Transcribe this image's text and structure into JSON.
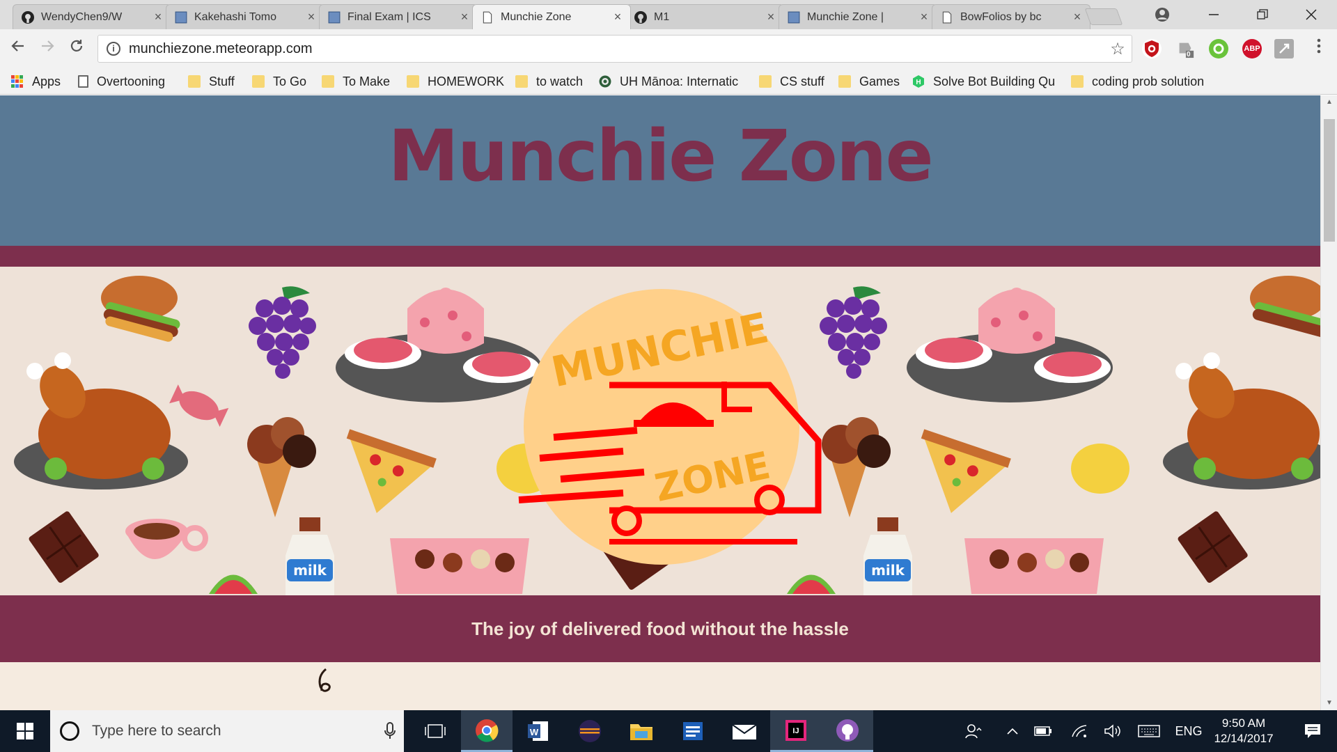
{
  "tabs": [
    {
      "title": "WendyChen9/W",
      "icon": "github-icon"
    },
    {
      "title": "Kakehashi Tomo",
      "icon": "page-blue-icon"
    },
    {
      "title": "Final Exam | ICS",
      "icon": "page-blue-icon"
    },
    {
      "title": "Munchie Zone",
      "icon": "page-icon"
    },
    {
      "title": "M1",
      "icon": "github-icon"
    },
    {
      "title": "Munchie Zone |",
      "icon": "page-blue-icon"
    },
    {
      "title": "BowFolios by bc",
      "icon": "page-icon"
    }
  ],
  "tab_close": "×",
  "address": {
    "url": "munchiezone.meteorapp.com"
  },
  "bookmarks": [
    {
      "label": "Apps",
      "icon": "apps-icon"
    },
    {
      "label": "Overtooning",
      "icon": "page-icon"
    },
    {
      "label": "Stuff",
      "icon": "folder-icon"
    },
    {
      "label": "To Go",
      "icon": "folder-icon"
    },
    {
      "label": "To Make",
      "icon": "folder-icon"
    },
    {
      "label": "HOMEWORK",
      "icon": "folder-icon"
    },
    {
      "label": "to watch",
      "icon": "folder-icon"
    },
    {
      "label": "UH Mānoa: Internatic",
      "icon": "uh-seal-icon"
    },
    {
      "label": "CS stuff",
      "icon": "folder-icon"
    },
    {
      "label": "Games",
      "icon": "folder-icon"
    },
    {
      "label": "Solve Bot Building Qu",
      "icon": "hackerrank-icon"
    },
    {
      "label": "coding prob solution",
      "icon": "folder-icon"
    }
  ],
  "extensions": {
    "badge_count": "0",
    "abp_label": "ABP"
  },
  "page": {
    "title": "Munchie Zone",
    "logo_top_text": "MUNCHIE",
    "logo_bottom_text": "ZONE",
    "tagline": "The joy of delivered food without the hassle",
    "colors": {
      "header_bg": "#597995",
      "accent": "#7d2f4d",
      "logo_bg": "#ffd08a",
      "logo_ink": "#ff0000"
    }
  },
  "taskbar": {
    "search_placeholder": "Type here to search",
    "language": "ENG",
    "time": "9:50 AM",
    "date": "12/14/2017"
  }
}
